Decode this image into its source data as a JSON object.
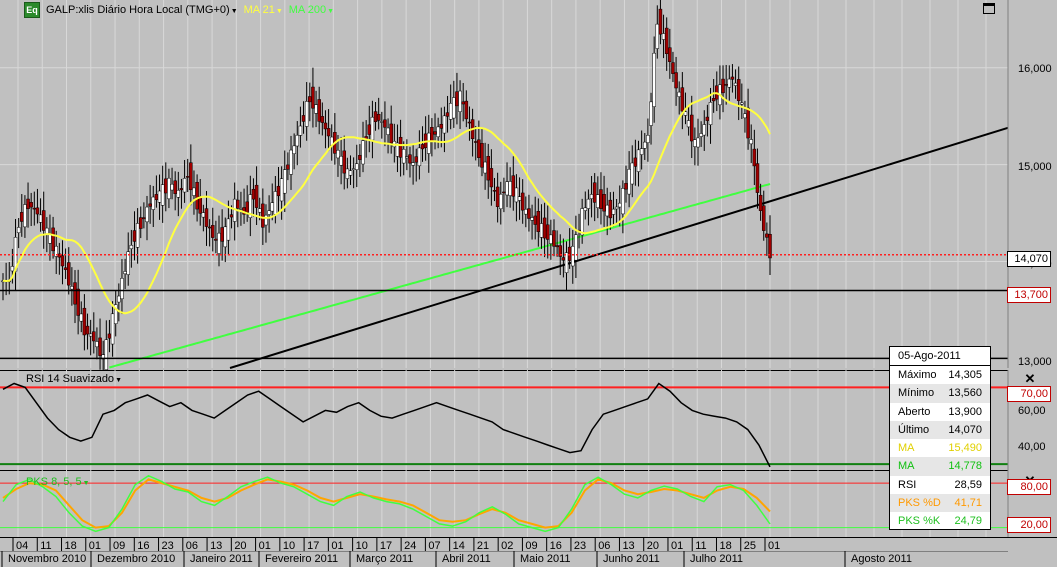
{
  "window": {
    "logo": "Eq",
    "symbol_title": "GALP:xlis Diário Hora Local (TMG+0)",
    "ma21_label": "MA 21",
    "ma200_label": "MA 200"
  },
  "price_axis": {
    "ticks": [
      "16,000",
      "15,000",
      "14,000",
      "13,000"
    ],
    "last_price": "14,070",
    "level_red": "13,700"
  },
  "rsi_panel": {
    "label": "RSI 14 Suavizado",
    "ticks": [
      "70,00",
      "60,00",
      "40,00"
    ]
  },
  "pks_panel": {
    "label": "PKS 8, 5, 5",
    "ticks": [
      "80,00",
      "20,00"
    ]
  },
  "info_box": {
    "date": "05-Ago-2011",
    "rows": [
      {
        "label": "Máximo",
        "value": "14,305"
      },
      {
        "label": "Mínimo",
        "value": "13,560"
      },
      {
        "label": "Aberto",
        "value": "13,900"
      },
      {
        "label": "Último",
        "value": "14,070"
      },
      {
        "label": "MA",
        "value": "15,490"
      },
      {
        "label": "MA",
        "value": "14,778"
      },
      {
        "label": "RSI",
        "value": "28,59"
      },
      {
        "label": "PKS %D",
        "value": "41,71"
      },
      {
        "label": "PKS %K",
        "value": "24,79"
      }
    ]
  },
  "date_axis": {
    "days": [
      "04",
      "11",
      "18",
      "01",
      "09",
      "16",
      "23",
      "06",
      "13",
      "20",
      "01",
      "10",
      "17",
      "01",
      "10",
      "17",
      "24",
      "07",
      "14",
      "21",
      "02",
      "09",
      "16",
      "23",
      "06",
      "13",
      "20",
      "01",
      "11",
      "18",
      "25",
      "01"
    ],
    "months": [
      "Novembro 2010",
      "Dezembro 2010",
      "Janeiro 2011",
      "Fevereiro 2011",
      "Março 2011",
      "Abril 2011",
      "Maio 2011",
      "Junho 2011",
      "Julho 2011",
      "Agosto 2011"
    ]
  },
  "colors": {
    "background": "#c0c0c0",
    "ma21": "#ffff40",
    "ma200": "#40ff40",
    "red_level": "#ff2020",
    "candle_up": "#ffffff",
    "candle_down": "#a00000"
  },
  "chart_data": [
    {
      "type": "candlestick",
      "title": "GALP:xlis Diário Hora Local (TMG+0)",
      "ylim": [
        12.9,
        16.7
      ],
      "closes": [
        13.8,
        14.4,
        14.6,
        14.5,
        14.3,
        14.1,
        13.9,
        13.6,
        13.3,
        13.2,
        13.0,
        13.4,
        13.8,
        14.2,
        14.4,
        14.6,
        14.7,
        14.8,
        14.7,
        14.9,
        14.6,
        14.4,
        14.2,
        14.3,
        14.6,
        14.5,
        14.7,
        14.4,
        14.6,
        14.8,
        15.1,
        15.4,
        15.7,
        15.5,
        15.3,
        15.1,
        14.9,
        15.0,
        15.3,
        15.5,
        15.4,
        15.2,
        15.1,
        15.0,
        15.2,
        15.3,
        15.4,
        15.6,
        15.7,
        15.4,
        15.1,
        14.9,
        14.6,
        14.8,
        14.7,
        14.5,
        14.4,
        14.3,
        14.2,
        14.0,
        14.1,
        14.5,
        14.7,
        14.6,
        14.5,
        14.6,
        14.9,
        15.1,
        15.3,
        16.5,
        16.2,
        15.8,
        15.5,
        15.2,
        15.4,
        15.7,
        15.8,
        15.9,
        15.6,
        15.2,
        14.5,
        14.07
      ],
      "series": [
        {
          "name": "MA 21"
        },
        {
          "name": "MA 200"
        }
      ],
      "hlines": [
        14.07,
        13.7,
        13.0
      ]
    },
    {
      "type": "line",
      "title": "RSI 14 Suavizado",
      "ylim": [
        28,
        78
      ],
      "hlines": [
        70,
        30
      ],
      "values": [
        69,
        72,
        70,
        62,
        54,
        48,
        44,
        42,
        44,
        56,
        58,
        62,
        64,
        66,
        63,
        60,
        62,
        58,
        56,
        54,
        58,
        62,
        66,
        68,
        64,
        60,
        56,
        52,
        55,
        58,
        57,
        60,
        62,
        58,
        55,
        54,
        56,
        58,
        60,
        62,
        60,
        58,
        56,
        54,
        52,
        48,
        46,
        44,
        42,
        40,
        38,
        36,
        37,
        48,
        56,
        58,
        60,
        62,
        64,
        72,
        68,
        62,
        58,
        56,
        55,
        54,
        52,
        48,
        40,
        28.59
      ]
    },
    {
      "type": "line",
      "title": "PKS 8, 5, 5",
      "ylim": [
        10,
        95
      ],
      "hlines": [
        80,
        20
      ],
      "series": [
        {
          "name": "PKS %D",
          "values": [
            60,
            72,
            80,
            78,
            70,
            50,
            30,
            20,
            22,
            40,
            70,
            85,
            80,
            75,
            70,
            60,
            55,
            60,
            70,
            78,
            85,
            82,
            78,
            70,
            60,
            55,
            60,
            65,
            62,
            58,
            55,
            50,
            40,
            30,
            28,
            30,
            38,
            45,
            40,
            30,
            25,
            20,
            22,
            40,
            70,
            85,
            80,
            70,
            65,
            68,
            72,
            70,
            65,
            60,
            70,
            75,
            72,
            60,
            41.71
          ]
        },
        {
          "name": "PKS %K",
          "values": [
            55,
            78,
            85,
            75,
            62,
            40,
            22,
            15,
            20,
            45,
            78,
            90,
            82,
            72,
            68,
            55,
            50,
            62,
            75,
            82,
            88,
            80,
            75,
            65,
            55,
            50,
            62,
            68,
            60,
            55,
            52,
            45,
            35,
            25,
            22,
            28,
            40,
            48,
            38,
            25,
            20,
            15,
            20,
            45,
            78,
            88,
            78,
            65,
            60,
            70,
            76,
            72,
            62,
            55,
            75,
            78,
            70,
            50,
            24.79
          ]
        }
      ]
    }
  ]
}
